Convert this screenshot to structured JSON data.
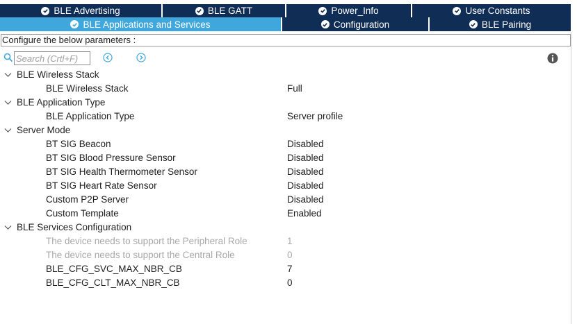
{
  "tabs_row1": [
    {
      "label": "BLE Advertising"
    },
    {
      "label": "BLE GATT"
    },
    {
      "label": "Power_Info"
    },
    {
      "label": "User Constants"
    }
  ],
  "tabs_row2": [
    {
      "label": "BLE Applications and Services",
      "active": true
    },
    {
      "label": "Configuration"
    },
    {
      "label": "BLE Pairing"
    }
  ],
  "configure_text": "Configure the below parameters :",
  "search": {
    "placeholder": "Search (Crtl+F)",
    "value": ""
  },
  "groups": [
    {
      "label": "BLE Wireless Stack",
      "params": [
        {
          "label": "BLE Wireless Stack",
          "value": "Full"
        }
      ]
    },
    {
      "label": "BLE Application Type",
      "params": [
        {
          "label": "BLE Application Type",
          "value": "Server profile"
        }
      ]
    },
    {
      "label": "Server Mode",
      "params": [
        {
          "label": "BT SIG Beacon",
          "value": "Disabled"
        },
        {
          "label": "BT SIG Blood Pressure Sensor",
          "value": "Disabled"
        },
        {
          "label": "BT SIG Health Thermometer Sensor",
          "value": "Disabled"
        },
        {
          "label": "BT SIG Heart Rate Sensor",
          "value": "Disabled"
        },
        {
          "label": "Custom P2P Server",
          "value": "Disabled"
        },
        {
          "label": "Custom Template",
          "value": "Enabled"
        }
      ]
    },
    {
      "label": "BLE Services Configuration",
      "params": [
        {
          "label": "The device needs to support the Peripheral Role",
          "value": "1",
          "disabled": true
        },
        {
          "label": "The device needs to support the Central Role",
          "value": "0",
          "disabled": true
        },
        {
          "label": "BLE_CFG_SVC_MAX_NBR_CB",
          "value": "7"
        },
        {
          "label": "BLE_CFG_CLT_MAX_NBR_CB",
          "value": "0"
        }
      ]
    }
  ],
  "icons": {
    "tab_status": "check-circle-icon",
    "search": "search-icon",
    "previous": "chevron-left-circle-icon",
    "next": "chevron-right-circle-icon",
    "info": "info-icon",
    "group_expanded": "chevron-down-icon"
  },
  "colors": {
    "tab_bg": "#0f2d55",
    "tab_active_bg": "#3fa7dc",
    "nav_icon": "#3fa7dc",
    "disabled_text": "#a8a8a8"
  }
}
